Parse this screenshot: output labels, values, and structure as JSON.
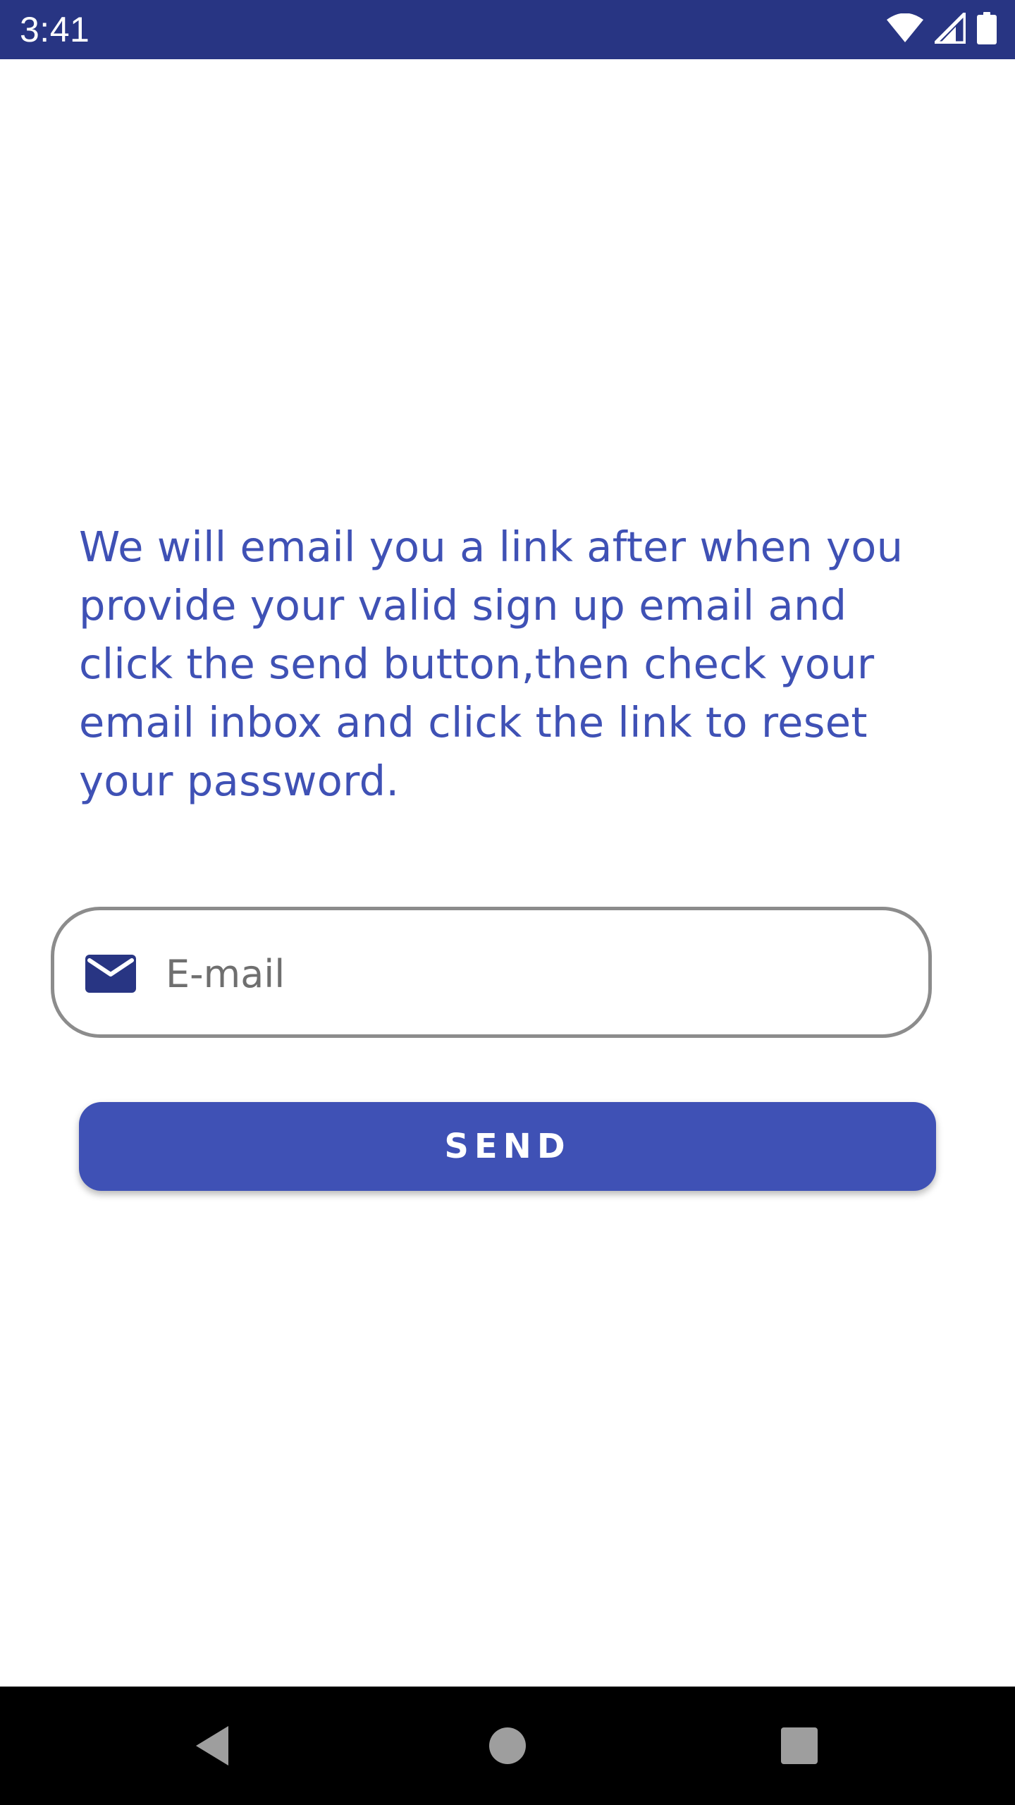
{
  "status_bar": {
    "time": "3:41",
    "background_color": "#283583",
    "icons": [
      "wifi-icon",
      "cellular-signal-icon",
      "battery-icon"
    ]
  },
  "reset_password": {
    "description": "We will email you a link after when you provide your valid sign up email and click the send button,then check your email inbox and click the link to reset your password.",
    "email_field": {
      "icon": "mail-icon",
      "placeholder": "E-mail",
      "value": ""
    },
    "send_label": "SEND",
    "accent_color": "#3f51b5"
  },
  "nav_bar": {
    "buttons": [
      "back-icon",
      "home-icon",
      "recents-icon"
    ]
  }
}
